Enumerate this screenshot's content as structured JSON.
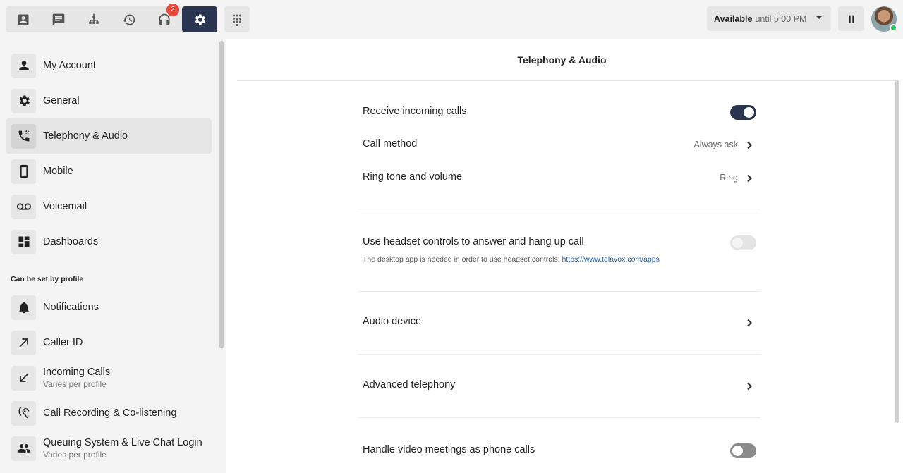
{
  "topbar": {
    "nav": [
      {
        "name": "contacts-icon"
      },
      {
        "name": "chat-icon"
      },
      {
        "name": "org-chart-icon"
      },
      {
        "name": "history-icon"
      },
      {
        "name": "headset-icon",
        "badge": "2"
      },
      {
        "name": "settings-icon",
        "active": true
      }
    ],
    "dialpad": "dialpad-icon",
    "status": {
      "label": "Available",
      "until": "until 5:00 PM"
    },
    "pause": "pause-icon"
  },
  "sidebar": {
    "items": [
      {
        "label": "My Account",
        "icon": "person-icon"
      },
      {
        "label": "General",
        "icon": "gear-icon"
      },
      {
        "label": "Telephony & Audio",
        "icon": "phone-icon",
        "active": true
      },
      {
        "label": "Mobile",
        "icon": "mobile-icon"
      },
      {
        "label": "Voicemail",
        "icon": "voicemail-icon"
      },
      {
        "label": "Dashboards",
        "icon": "dashboard-icon"
      }
    ],
    "section_label": "Can be set by profile",
    "profile_items": [
      {
        "label": "Notifications",
        "icon": "bell-icon"
      },
      {
        "label": "Caller ID",
        "icon": "arrow-outgoing-icon"
      },
      {
        "label": "Incoming Calls",
        "sub": "Varies per profile",
        "icon": "arrow-incoming-icon"
      },
      {
        "label": "Call Recording & Co-listening",
        "icon": "ear-icon"
      },
      {
        "label": "Queuing System & Live Chat Login",
        "sub": "Varies per profile",
        "icon": "group-icon"
      }
    ]
  },
  "main": {
    "title": "Telephony & Audio",
    "receive_calls": {
      "label": "Receive incoming calls",
      "state": "on"
    },
    "call_method": {
      "label": "Call method",
      "value": "Always ask"
    },
    "ring_tone": {
      "label": "Ring tone and volume",
      "value": "Ring"
    },
    "headset": {
      "label": "Use headset controls to answer and hang up call",
      "state": "disabled",
      "hint": "The desktop app is needed in order to use headset controls:",
      "link": "https://www.telavox.com/apps"
    },
    "audio_device": {
      "label": "Audio device"
    },
    "advanced": {
      "label": "Advanced telephony"
    },
    "video_meetings": {
      "label": "Handle video meetings as phone calls",
      "state": "off"
    }
  },
  "colors": {
    "accent": "#2a3552",
    "badge": "#e8483b",
    "online": "#2ec45a",
    "link": "#2a5fa8"
  }
}
